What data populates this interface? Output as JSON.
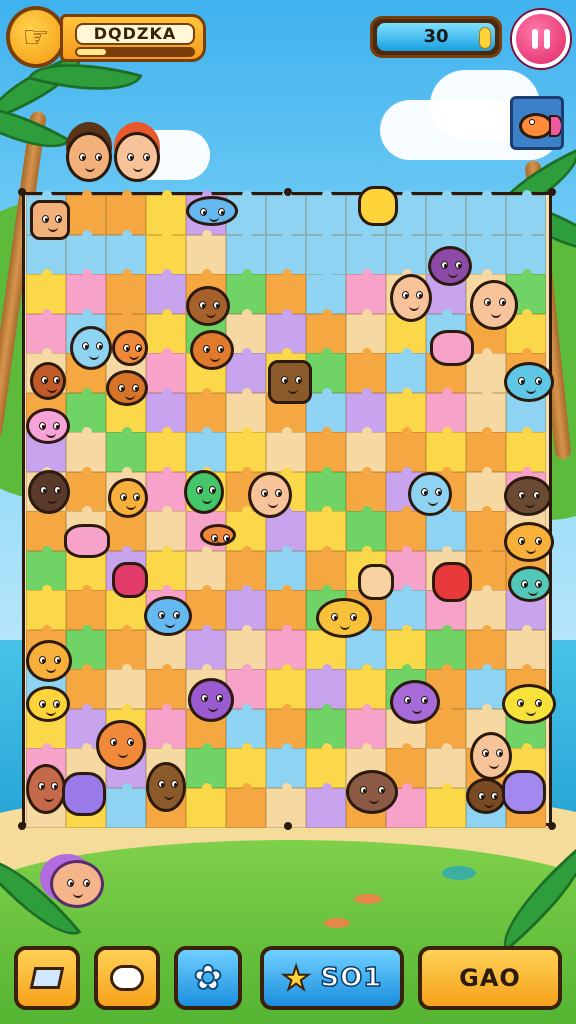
{
  "hud": {
    "back_icon": "hand-back-icon",
    "player_name": "DQDZKA",
    "progress": 0.25,
    "score": "30",
    "pause_icon": "pause-icon",
    "avatar_icon": "fish-avatar-icon"
  },
  "toolbar": {
    "layers_icon": "layers-icon",
    "face_icon": "cloud-face-icon",
    "settings_icon": "gear-icon",
    "coins_label": "SO1",
    "coins_icon": "star-icon",
    "go_label": "GAO"
  },
  "colors": {
    "orange": "#f5a742",
    "yellow": "#fbd84a",
    "sand": "#f6d9a2",
    "blue": "#8fd3f2",
    "green": "#6fd365",
    "purple": "#c8a4ee",
    "pink": "#f7a2c9",
    "accent_orange": "#f59b1a",
    "accent_blue": "#1b8fde",
    "accent_pink": "#e02566"
  }
}
